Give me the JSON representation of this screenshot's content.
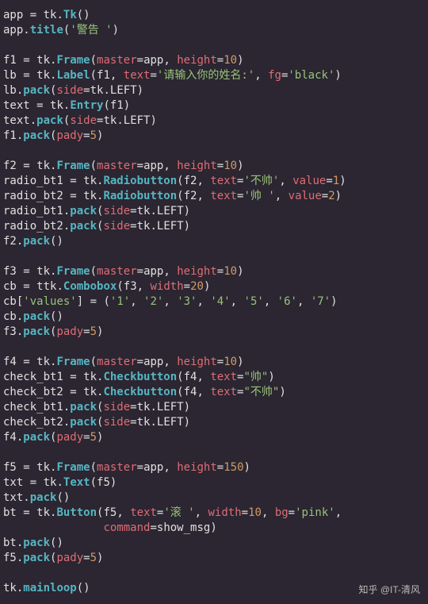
{
  "watermark": "知乎 @IT-清风",
  "code": {
    "l1": {
      "var": "app",
      "mod": "tk",
      "cls": "Tk"
    },
    "l2": {
      "var": "app",
      "m": "title",
      "s": "'警告 '"
    },
    "l3": {
      "var": "f1",
      "mod": "tk",
      "cls": "Frame",
      "a1": "master",
      "v1": "app",
      "a2": "height",
      "n2": "10"
    },
    "l4": {
      "var": "lb",
      "mod": "tk",
      "cls": "Label",
      "p1": "f1",
      "a1": "text",
      "s1": "'请输入你的姓名:'",
      "a2": "fg",
      "s2": "'black'"
    },
    "l5": {
      "var": "lb",
      "m": "pack",
      "a1": "side",
      "mod": "tk",
      "c": "LEFT"
    },
    "l6": {
      "var": "text",
      "mod": "tk",
      "cls": "Entry",
      "p1": "f1"
    },
    "l7": {
      "var": "text",
      "m": "pack",
      "a1": "side",
      "mod": "tk",
      "c": "LEFT"
    },
    "l8": {
      "var": "f1",
      "m": "pack",
      "a1": "pady",
      "n1": "5"
    },
    "l9": {
      "var": "f2",
      "mod": "tk",
      "cls": "Frame",
      "a1": "master",
      "v1": "app",
      "a2": "height",
      "n2": "10"
    },
    "l10": {
      "var": "radio_bt1",
      "mod": "tk",
      "cls": "Radiobutton",
      "p1": "f2",
      "a1": "text",
      "s1": "'不帅'",
      "a2": "value",
      "n2": "1"
    },
    "l11": {
      "var": "radio_bt2",
      "mod": "tk",
      "cls": "Radiobutton",
      "p1": "f2",
      "a1": "text",
      "s1": "'帅 '",
      "a2": "value",
      "n2": "2"
    },
    "l12": {
      "var": "radio_bt1",
      "m": "pack",
      "a1": "side",
      "mod": "tk",
      "c": "LEFT"
    },
    "l13": {
      "var": "radio_bt2",
      "m": "pack",
      "a1": "side",
      "mod": "tk",
      "c": "LEFT"
    },
    "l14": {
      "var": "f2",
      "m": "pack"
    },
    "l15": {
      "var": "f3",
      "mod": "tk",
      "cls": "Frame",
      "a1": "master",
      "v1": "app",
      "a2": "height",
      "n2": "10"
    },
    "l16": {
      "var": "cb",
      "mod": "ttk",
      "cls": "Combobox",
      "p1": "f3",
      "a1": "width",
      "n1": "20"
    },
    "l17": {
      "var": "cb",
      "k": "'values'",
      "vals": [
        "'1'",
        "'2'",
        "'3'",
        "'4'",
        "'5'",
        "'6'",
        "'7'"
      ]
    },
    "l18": {
      "var": "cb",
      "m": "pack"
    },
    "l19": {
      "var": "f3",
      "m": "pack",
      "a1": "pady",
      "n1": "5"
    },
    "l20": {
      "var": "f4",
      "mod": "tk",
      "cls": "Frame",
      "a1": "master",
      "v1": "app",
      "a2": "height",
      "n2": "10"
    },
    "l21": {
      "var": "check_bt1",
      "mod": "tk",
      "cls": "Checkbutton",
      "p1": "f4",
      "a1": "text",
      "s1": "\"帅\""
    },
    "l22": {
      "var": "check_bt2",
      "mod": "tk",
      "cls": "Checkbutton",
      "p1": "f4",
      "a1": "text",
      "s1": "\"不帅\""
    },
    "l23": {
      "var": "check_bt1",
      "m": "pack",
      "a1": "side",
      "mod": "tk",
      "c": "LEFT"
    },
    "l24": {
      "var": "check_bt2",
      "m": "pack",
      "a1": "side",
      "mod": "tk",
      "c": "LEFT"
    },
    "l25": {
      "var": "f4",
      "m": "pack",
      "a1": "pady",
      "n1": "5"
    },
    "l26": {
      "var": "f5",
      "mod": "tk",
      "cls": "Frame",
      "a1": "master",
      "v1": "app",
      "a2": "height",
      "n2": "150"
    },
    "l27": {
      "var": "txt",
      "mod": "tk",
      "cls": "Text",
      "p1": "f5"
    },
    "l28": {
      "var": "txt",
      "m": "pack"
    },
    "l29": {
      "var": "bt",
      "mod": "tk",
      "cls": "Button",
      "p1": "f5",
      "a1": "text",
      "s1": "'滚 '",
      "a2": "width",
      "n2": "10",
      "a3": "bg",
      "s3": "'pink'"
    },
    "l29b": {
      "a1": "command",
      "v1": "show_msg"
    },
    "l30": {
      "var": "bt",
      "m": "pack"
    },
    "l31": {
      "var": "f5",
      "m": "pack",
      "a1": "pady",
      "n1": "5"
    },
    "l32": {
      "mod": "tk",
      "m": "mainloop"
    }
  }
}
